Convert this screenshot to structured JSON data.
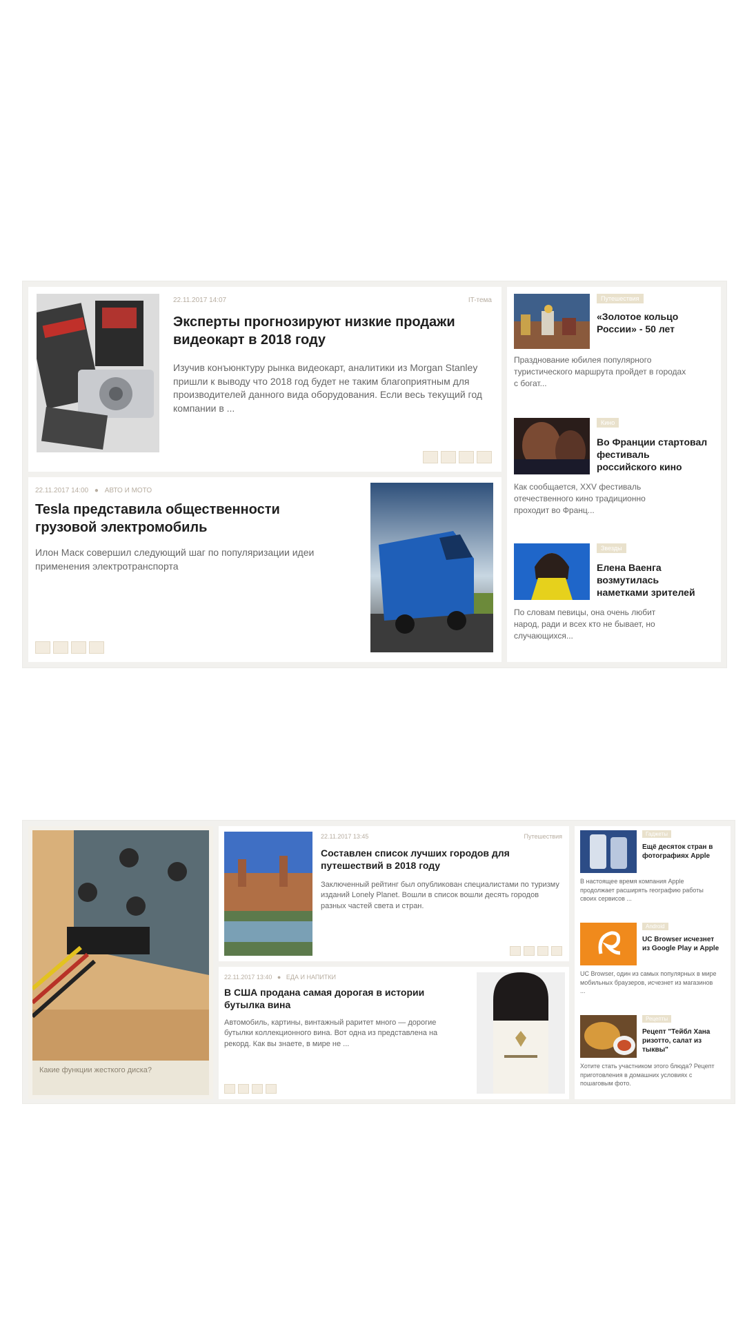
{
  "block1": {
    "card1": {
      "date": "22.11.2017 14:07",
      "category": "IT-тема",
      "title": "Эксперты прогнозируют низкие продажи видеокарт в 2018 году",
      "excerpt": "Изучив конъюнктуру рынка видеокарт, аналитики из Morgan Stanley пришли к выводу что 2018 год будет не таким благоприятным для производителей данного вида оборудования. Если весь текущий год компании в ..."
    },
    "card2": {
      "date": "22.11.2017 14:00",
      "category": "АВТО И МОТО",
      "title": "Tesla представила общественности грузовой электромобиль",
      "excerpt": "Илон Маск совершил следующий шаг по популяризации идеи применения электротранспорта"
    },
    "side": [
      {
        "badge": "Путешествия",
        "title": "«Золотое кольцо России» - 50 лет",
        "excerpt": "Празднование юбилея популярного туристического маршрута пройдет в городах с богат..."
      },
      {
        "badge": "Кино",
        "title": "Во Франции стартовал фестиваль российского кино",
        "excerpt": "Как сообщается, XXV фестиваль отечественного кино традиционно проходит во Франц..."
      },
      {
        "badge": "Звезды",
        "title": "Елена Ваенга возмутилась наметками зрителей",
        "excerpt": "По словам певицы, она очень любит народ, ради и всех кто не бывает, но случающихся..."
      }
    ]
  },
  "block2": {
    "feature": {
      "caption": "Какие функции жесткого диска?"
    },
    "card1": {
      "date": "22.11.2017 13:45",
      "category": "Путешествия",
      "title": "Составлен список лучших городов для путешествий в 2018 году",
      "excerpt": "Заключенный рейтинг был опубликован специалистами по туризму изданий Lonely Planet. Вошли в список вошли десять городов разных частей света и стран."
    },
    "card2": {
      "date": "22.11.2017 13:40",
      "category": "ЕДА И НАПИТКИ",
      "title": "В США продана самая дорогая в истории бутылка вина",
      "excerpt": "Автомобиль, картины, винтажный раритет много — дорогие бутылки коллекционного вина. Вот одна из представлена на рекорд. Как вы знаете, в мире не ..."
    },
    "side": [
      {
        "badge": "Гаджеты",
        "title": "Ещё десяток стран в фотографиях Apple",
        "excerpt": "В настоящее время компания Apple продолжает расширять географию работы своих сервисов ..."
      },
      {
        "badge": "Android",
        "title": "UC Browser исчезнет из Google Play и Apple",
        "excerpt": "UC Browser, один из самых популярных в мире мобильных браузеров, исчезнет из магазинов ..."
      },
      {
        "badge": "Рецепты",
        "title": "Рецепт \"Тейбл Хана ризотто, салат из тыквы\"",
        "excerpt": "Хотите стать участником этого блюда? Рецепт приготовления в домашних условиях с пошаговым фото."
      }
    ]
  }
}
